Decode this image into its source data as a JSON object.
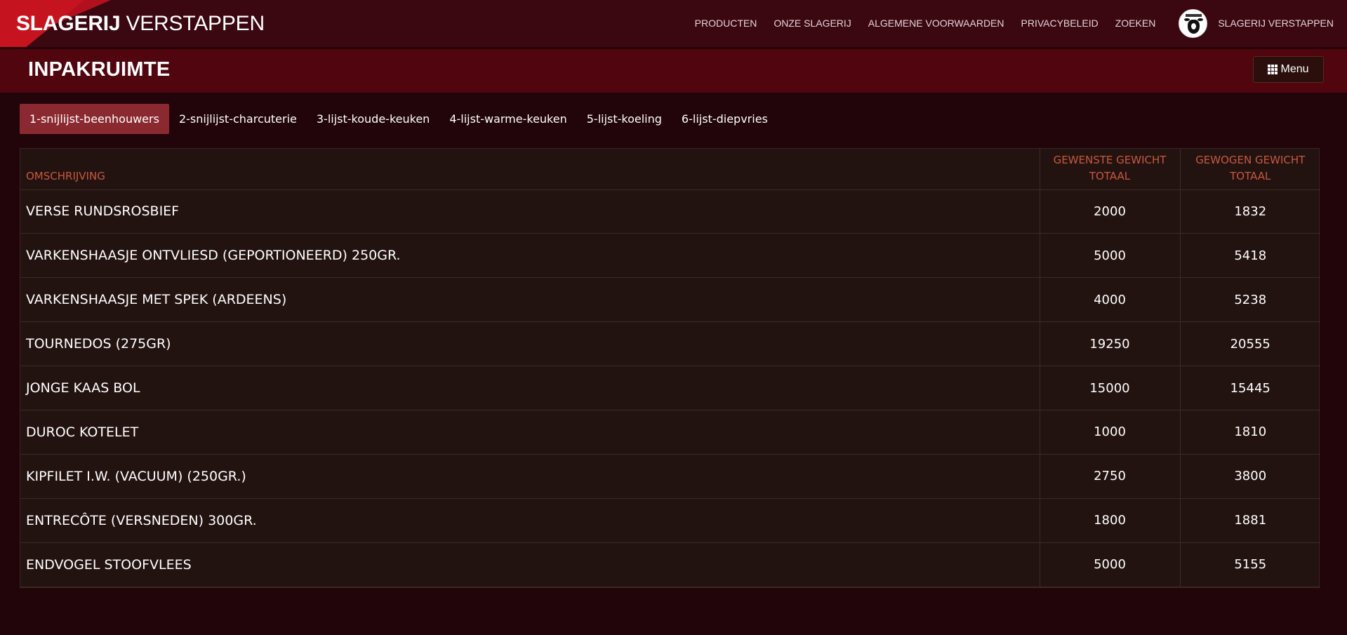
{
  "brand": {
    "strong": "SLAGERIJ",
    "light": "VERSTAPPEN"
  },
  "nav": {
    "links": [
      "PRODUCTEN",
      "ONZE SLAGERIJ",
      "ALGEMENE VOORWAARDEN",
      "PRIVACYBELEID",
      "ZOEKEN"
    ],
    "user_name": "SLAGERIJ VERSTAPPEN",
    "avatar_icon": "cow-logo-icon"
  },
  "page": {
    "title": "INPAKRUIMTE",
    "menu_label": "Menu",
    "menu_icon": "grid-icon"
  },
  "tabs": [
    {
      "label": "1-snijlijst-beenhouwers",
      "active": true
    },
    {
      "label": "2-snijlijst-charcuterie",
      "active": false
    },
    {
      "label": "3-lijst-koude-keuken",
      "active": false
    },
    {
      "label": "4-lijst-warme-keuken",
      "active": false
    },
    {
      "label": "5-lijst-koeling",
      "active": false
    },
    {
      "label": "6-lijst-diepvries",
      "active": false
    }
  ],
  "table": {
    "headers": {
      "description": "OMSCHRIJVING",
      "desired_line1": "GEWENSTE GEWICHT",
      "desired_line2": "TOTAAL",
      "weighed_line1": "GEWOGEN GEWICHT",
      "weighed_line2": "TOTAAL"
    },
    "rows": [
      {
        "description": "VERSE RUNDSROSBIEF",
        "desired": "2000",
        "weighed": "1832"
      },
      {
        "description": "VARKENSHAASJE ONTVLIESD (GEPORTIONEERD) 250GR.",
        "desired": "5000",
        "weighed": "5418"
      },
      {
        "description": "VARKENSHAASJE MET SPEK (ARDEENS)",
        "desired": "4000",
        "weighed": "5238"
      },
      {
        "description": "TOURNEDOS (275GR)",
        "desired": "19250",
        "weighed": "20555"
      },
      {
        "description": "JONGE KAAS BOL",
        "desired": "15000",
        "weighed": "15445"
      },
      {
        "description": "DUROC KOTELET",
        "desired": "1000",
        "weighed": "1810"
      },
      {
        "description": "KIPFILET I.W. (VACUUM) (250GR.)",
        "desired": "2750",
        "weighed": "3800"
      },
      {
        "description": "ENTRECÔTE (VERSNEDEN) 300GR.",
        "desired": "1800",
        "weighed": "1881"
      },
      {
        "description": "ENDVOGEL STOOFVLEES",
        "desired": "5000",
        "weighed": "5155"
      }
    ]
  },
  "colors": {
    "navbar_bg": "#3b0711",
    "brand_red": "#c5141f",
    "header_bg": "#50050f",
    "body_bg": "#22050a",
    "active_tab": "#8a2a30",
    "table_bg": "#231310",
    "header_text": "#c9573f"
  }
}
